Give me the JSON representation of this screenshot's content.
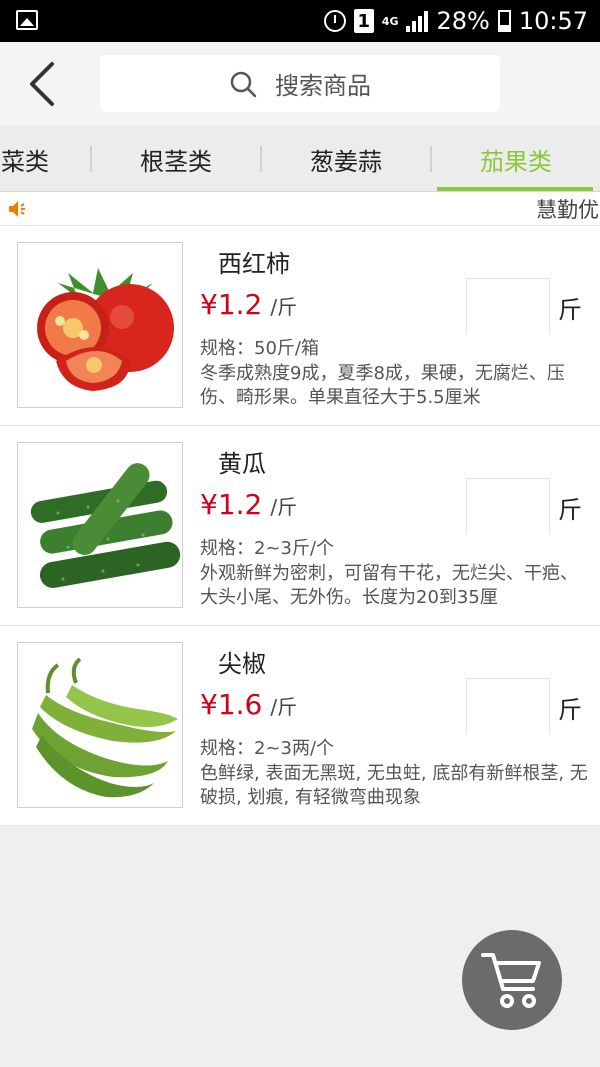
{
  "status_bar": {
    "sim": "1",
    "network": "4G",
    "battery": "28%",
    "time": "10:57",
    "icons": [
      "gallery-icon",
      "alarm-icon",
      "sim-icon",
      "signal-icon",
      "battery-icon"
    ]
  },
  "header": {
    "back_icon": "chevron-left-icon",
    "search_icon": "search-icon",
    "search_placeholder": "搜索商品"
  },
  "tabs": [
    {
      "label": "菜类",
      "active": false
    },
    {
      "label": "根茎类",
      "active": false
    },
    {
      "label": "葱姜蒜",
      "active": false
    },
    {
      "label": "茄果类",
      "active": true
    }
  ],
  "notice": {
    "icon": "speaker-icon",
    "text": "慧勤优"
  },
  "products": [
    {
      "name": "西红柿",
      "price": "¥1.2",
      "price_unit": "/斤",
      "spec": "规格：50斤/箱",
      "desc": "冬季成熟度9成，夏季8成，果硬，无腐烂、压伤、畸形果。单果直径大于5.5厘米",
      "qty_unit": "斤",
      "image": "tomato"
    },
    {
      "name": "黄瓜",
      "price": "¥1.2",
      "price_unit": "/斤",
      "spec": "规格：2~3斤/个",
      "desc": "外观新鲜为密刺，可留有干花，无烂尖、干疤、大头小尾、无外伤。长度为20到35厘",
      "qty_unit": "斤",
      "image": "cucumber"
    },
    {
      "name": "尖椒",
      "price": "¥1.6",
      "price_unit": "/斤",
      "spec": "规格：2~3两/个",
      "desc": "色鲜绿, 表面无黑斑, 无虫蛀, 底部有新鲜根茎, 无破损, 划痕, 有轻微弯曲现象",
      "qty_unit": "斤",
      "image": "pepper"
    }
  ],
  "colors": {
    "accent": "#8cc63f",
    "price": "#d0021b",
    "cart_fab": "#6b6b6b"
  },
  "cart_icon": "shopping-cart-icon"
}
